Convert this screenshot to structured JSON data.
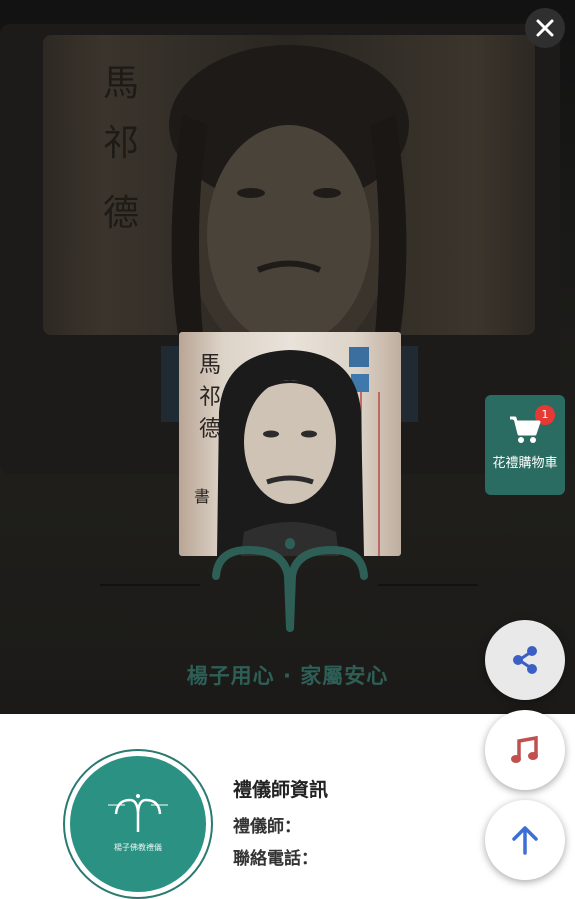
{
  "lightbox": {
    "close_label": "✕",
    "tagline": "楊子用心 · 家屬安心"
  },
  "cart": {
    "badge_count": "1",
    "label": "花禮購物車"
  },
  "profile": {
    "logo_text": "楊子佛教禮儀"
  },
  "info": {
    "title": "禮儀師資訊",
    "officiant_label": "禮儀師：",
    "phone_label": "聯絡電話："
  },
  "colors": {
    "brand_teal": "#2b9283",
    "cart_bg": "#2a6b62",
    "badge_red": "#e53935",
    "share_blue": "#3b5fc4",
    "music_red": "#c0504d",
    "arrow_blue": "#3b6fd4"
  }
}
